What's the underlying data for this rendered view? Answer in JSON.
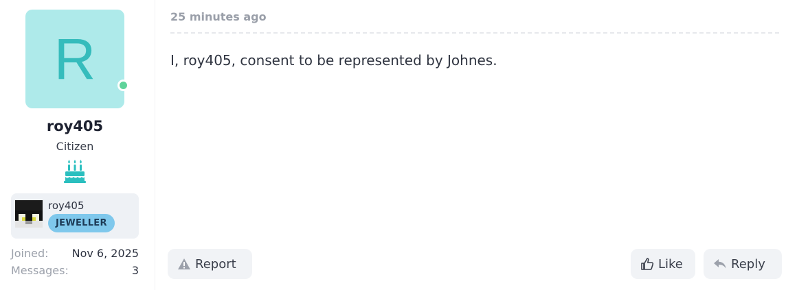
{
  "user": {
    "avatar_letter": "R",
    "username": "roy405",
    "title": "Citizen",
    "online_color": "#5fd39a",
    "avatar_bg": "#aeeaea",
    "avatar_fg": "#35bcbc"
  },
  "minecraft": {
    "name": "roy405",
    "rank": "JEWELLER"
  },
  "stats": [
    {
      "label": "Joined:",
      "value": "Nov 6, 2025"
    },
    {
      "label": "Messages:",
      "value": "3"
    }
  ],
  "post": {
    "time": "25 minutes ago",
    "body": "I, roy405, consent to be represented by Johnes."
  },
  "actions": {
    "report": "Report",
    "like": "Like",
    "reply": "Reply"
  },
  "icons": {
    "cake": "birthday-cake-icon",
    "report": "warning-triangle-icon",
    "like": "thumbs-up-icon",
    "reply": "reply-arrow-icon"
  }
}
